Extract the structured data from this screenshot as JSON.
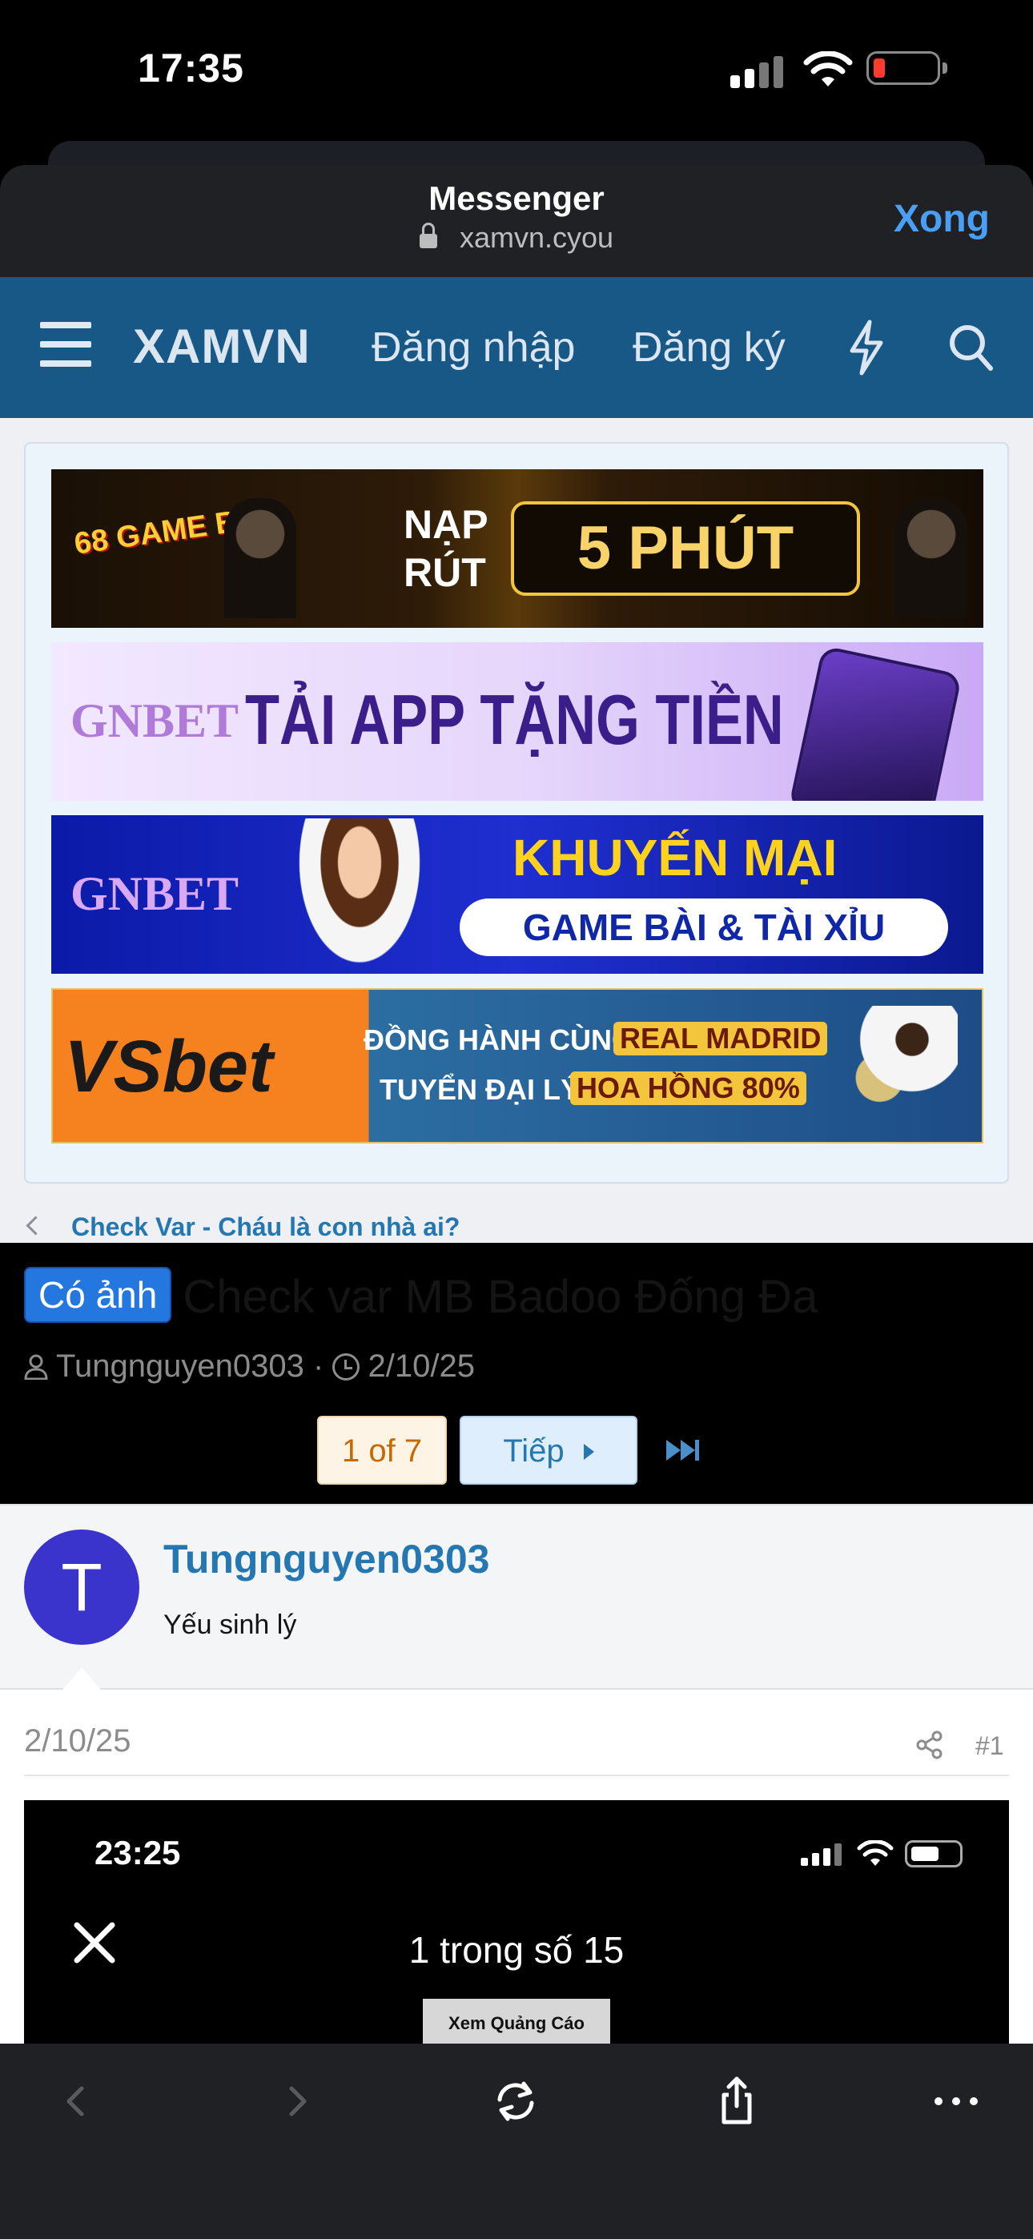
{
  "status_bar": {
    "time": "17:35"
  },
  "app_header": {
    "app_name": "Messenger",
    "url": "xamvn.cyou",
    "done_label": "Xong"
  },
  "site_nav": {
    "brand": "XAMVN",
    "login": "Đăng nhập",
    "register": "Đăng ký"
  },
  "banners": [
    {
      "brand": "68 GAME BÀI",
      "line1": "NẠP",
      "line2": "RÚT",
      "headline": "5 PHÚT"
    },
    {
      "brand": "GNBET",
      "headline": "TẢI APP TẶNG TIỀN"
    },
    {
      "brand": "GNBET",
      "headline": "KHUYẾN MẠI",
      "sub": "GAME BÀI & TÀI XỈU"
    },
    {
      "brand": "VSbet",
      "line1_a": "ĐỒNG HÀNH CÙNG",
      "line1_b": "REAL MADRID",
      "line2_a": "TUYỂN ĐẠI LÝ",
      "line2_b": "HOA HỒNG 80%"
    }
  ],
  "thread": {
    "breadcrumb": "Check Var - Cháu là con nhà ai?",
    "prefix": "Có ảnh",
    "title": "Check var MB Badoo Đống Đa",
    "author": "Tungnguyen0303",
    "separator": "·",
    "date": "2/10/25"
  },
  "pagination": {
    "current": "1 of 7",
    "next_label": "Tiếp"
  },
  "post": {
    "avatar_letter": "T",
    "username": "Tungnguyen0303",
    "user_title": "Yếu sinh lý",
    "date": "2/10/25",
    "number": "#1",
    "embedded_screenshot": {
      "time": "23:25",
      "title": "1 trong số 15",
      "ad_label": "Xem Quảng Cáo"
    }
  },
  "colors": {
    "nav_bg": "#185886",
    "link": "#2577b1",
    "accent": "#4a9ff5",
    "prefix_badge": "#2577e0"
  },
  "icons": [
    "hamburger-icon",
    "bolt-icon",
    "search-icon",
    "lock-icon",
    "chevron-left-icon",
    "user-icon",
    "clock-icon",
    "fast-forward-icon",
    "share-icon",
    "back-icon",
    "forward-icon",
    "reload-icon",
    "share-out-icon",
    "more-icon"
  ]
}
